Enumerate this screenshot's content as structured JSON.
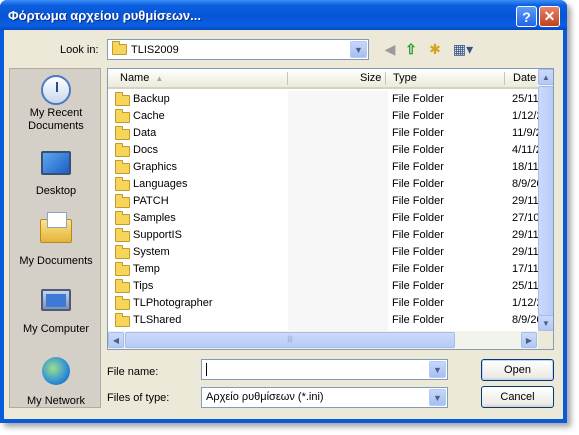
{
  "window": {
    "title": "Φόρτωμα αρχείου ρυθμίσεων..."
  },
  "titlebar_buttons": {
    "help": "?",
    "close": "✕"
  },
  "lookin": {
    "label": "Look in:",
    "value": "TLIS2009"
  },
  "places": [
    {
      "label": "My Recent Documents",
      "icon": "recent-documents-icon"
    },
    {
      "label": "Desktop",
      "icon": "desktop-icon"
    },
    {
      "label": "My Documents",
      "icon": "my-documents-icon"
    },
    {
      "label": "My Computer",
      "icon": "my-computer-icon"
    },
    {
      "label": "My Network",
      "icon": "my-network-icon"
    }
  ],
  "columns": {
    "name": "Name",
    "size": "Size",
    "type": "Type",
    "date": "Date"
  },
  "files": [
    {
      "name": "Backup",
      "type": "File Folder",
      "date": "25/11"
    },
    {
      "name": "Cache",
      "type": "File Folder",
      "date": "1/12/2"
    },
    {
      "name": "Data",
      "type": "File Folder",
      "date": "11/9/2"
    },
    {
      "name": "Docs",
      "type": "File Folder",
      "date": "4/11/2"
    },
    {
      "name": "Graphics",
      "type": "File Folder",
      "date": "18/11"
    },
    {
      "name": "Languages",
      "type": "File Folder",
      "date": "8/9/20"
    },
    {
      "name": "PATCH",
      "type": "File Folder",
      "date": "29/11"
    },
    {
      "name": "Samples",
      "type": "File Folder",
      "date": "27/10"
    },
    {
      "name": "SupportIS",
      "type": "File Folder",
      "date": "29/11"
    },
    {
      "name": "System",
      "type": "File Folder",
      "date": "29/11"
    },
    {
      "name": "Temp",
      "type": "File Folder",
      "date": "17/11"
    },
    {
      "name": "Tips",
      "type": "File Folder",
      "date": "25/11"
    },
    {
      "name": "TLPhotographer",
      "type": "File Folder",
      "date": "1/12/2"
    },
    {
      "name": "TLShared",
      "type": "File Folder",
      "date": "8/9/20"
    }
  ],
  "filename": {
    "label": "File name:",
    "value": ""
  },
  "filetype": {
    "label": "Files of type:",
    "value": "Αρχείο ρυθμίσεων (*.ini)"
  },
  "buttons": {
    "open": "Open",
    "cancel": "Cancel"
  },
  "colors": {
    "titlebar": "#0754d6",
    "dialog_bg": "#ece9d8",
    "input_border": "#7f9db9"
  }
}
